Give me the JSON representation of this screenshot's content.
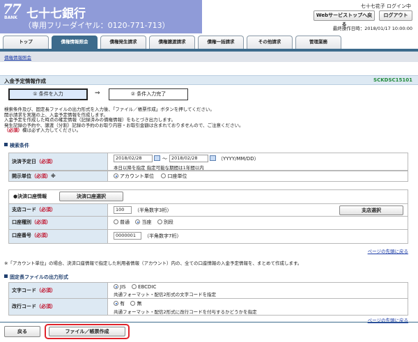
{
  "header": {
    "logo_num": "77",
    "logo_bank": "BANK",
    "bank_name": "七十七銀行",
    "free_dial": "（専用フリーダイヤル：0120-771-713）",
    "user_name": "七十七花子 ログイン中",
    "top_button": "Webサービストップへ戻る",
    "logout_button": "ログアウト",
    "last_login": "最終操作日時：2018/01/17 10:00:00"
  },
  "tabs": [
    {
      "label": "トップ"
    },
    {
      "label": "債権情報照会"
    },
    {
      "label": "債権発生請求"
    },
    {
      "label": "債権譲渡請求"
    },
    {
      "label": "債権一括請求"
    },
    {
      "label": "その他請求"
    },
    {
      "label": "管理業務"
    }
  ],
  "subnav": {
    "link": "債権情報照会"
  },
  "page": {
    "title": "入金予定情報作成",
    "screen_id": "SCKDSC15101",
    "step1": "① 条件を入力",
    "step_arrow": "⇒",
    "step2": "② 条件入力完了",
    "desc": [
      "検索条件及び、固定長ファイルの出力形式を入力後、「ファイル／帳票作成」ボタンを押してください。",
      "開示請求を実施の上、入金予定情報を作成します。",
      "入金予定を作成した時点の確定情報（記録済みの債権情報）をもとづき出力します。",
      "発生記録の予約や、譲渡（分割）記録の予約のお取り内容・お取引金額は含まれておりませんので、ご注意ください。"
    ],
    "desc_last_req": "（必須）",
    "desc_last_rest": "欄は必ず入力してください。"
  },
  "search": {
    "heading": "検索条件",
    "settle_label": "決済予定日",
    "req": "（必須）",
    "date_from": "2018/02/28",
    "tilde": "～",
    "date_to": "2018/02/28",
    "date_format": "（YYYY/MM/DD）",
    "date_note": "本日以降を指定 指定可能な期間は1年間以内",
    "unit_label": "開示単位",
    "unit_mark": "※",
    "unit_opt1": "アカウント単位",
    "unit_opt2": "口座単位",
    "acct_title": "●決済口座情報",
    "acct_select_button": "決済口座選択",
    "branch_label": "支店コード",
    "branch_value": "100",
    "branch_hint": "（半角数字3桁）",
    "branch_button": "支店選択",
    "type_label": "口座種別",
    "type_opt1": "普通",
    "type_opt2": "当座",
    "type_opt3": "別段",
    "number_label": "口座番号",
    "number_value": "0000001",
    "number_hint": "（半角数字7桁）",
    "page_top": "ページの先頭に戻る"
  },
  "note": "※「アカウント単位」の場合、決済口座情報で指定した利用者情報（アカウント）内の、全ての口座情報の入金予定情報を、まとめて作成します。",
  "output": {
    "heading": "固定長ファイルの出力形式",
    "charcode_label": "文字コード",
    "req": "（必須）",
    "charcode_opt1": "JIS",
    "charcode_opt2": "EBCDIC",
    "charcode_note": "共通フォーマット・配信2形式の文字コードを指定",
    "newline_label": "改行コード",
    "newline_opt1": "有",
    "newline_opt2": "無",
    "newline_note": "共通フォーマット・配信2形式に改行コードを付与するかどうかを指定",
    "page_top": "ページの先頭に戻る"
  },
  "footer": {
    "back_button": "戻る",
    "create_button": "ファイル／帳票作成"
  },
  "colors": {
    "brand": "#8f9bd8",
    "tab_active": "#3d6b8c",
    "label_bg": "#dde9f3",
    "required": "#c0102a",
    "highlight": "#e0232b"
  }
}
